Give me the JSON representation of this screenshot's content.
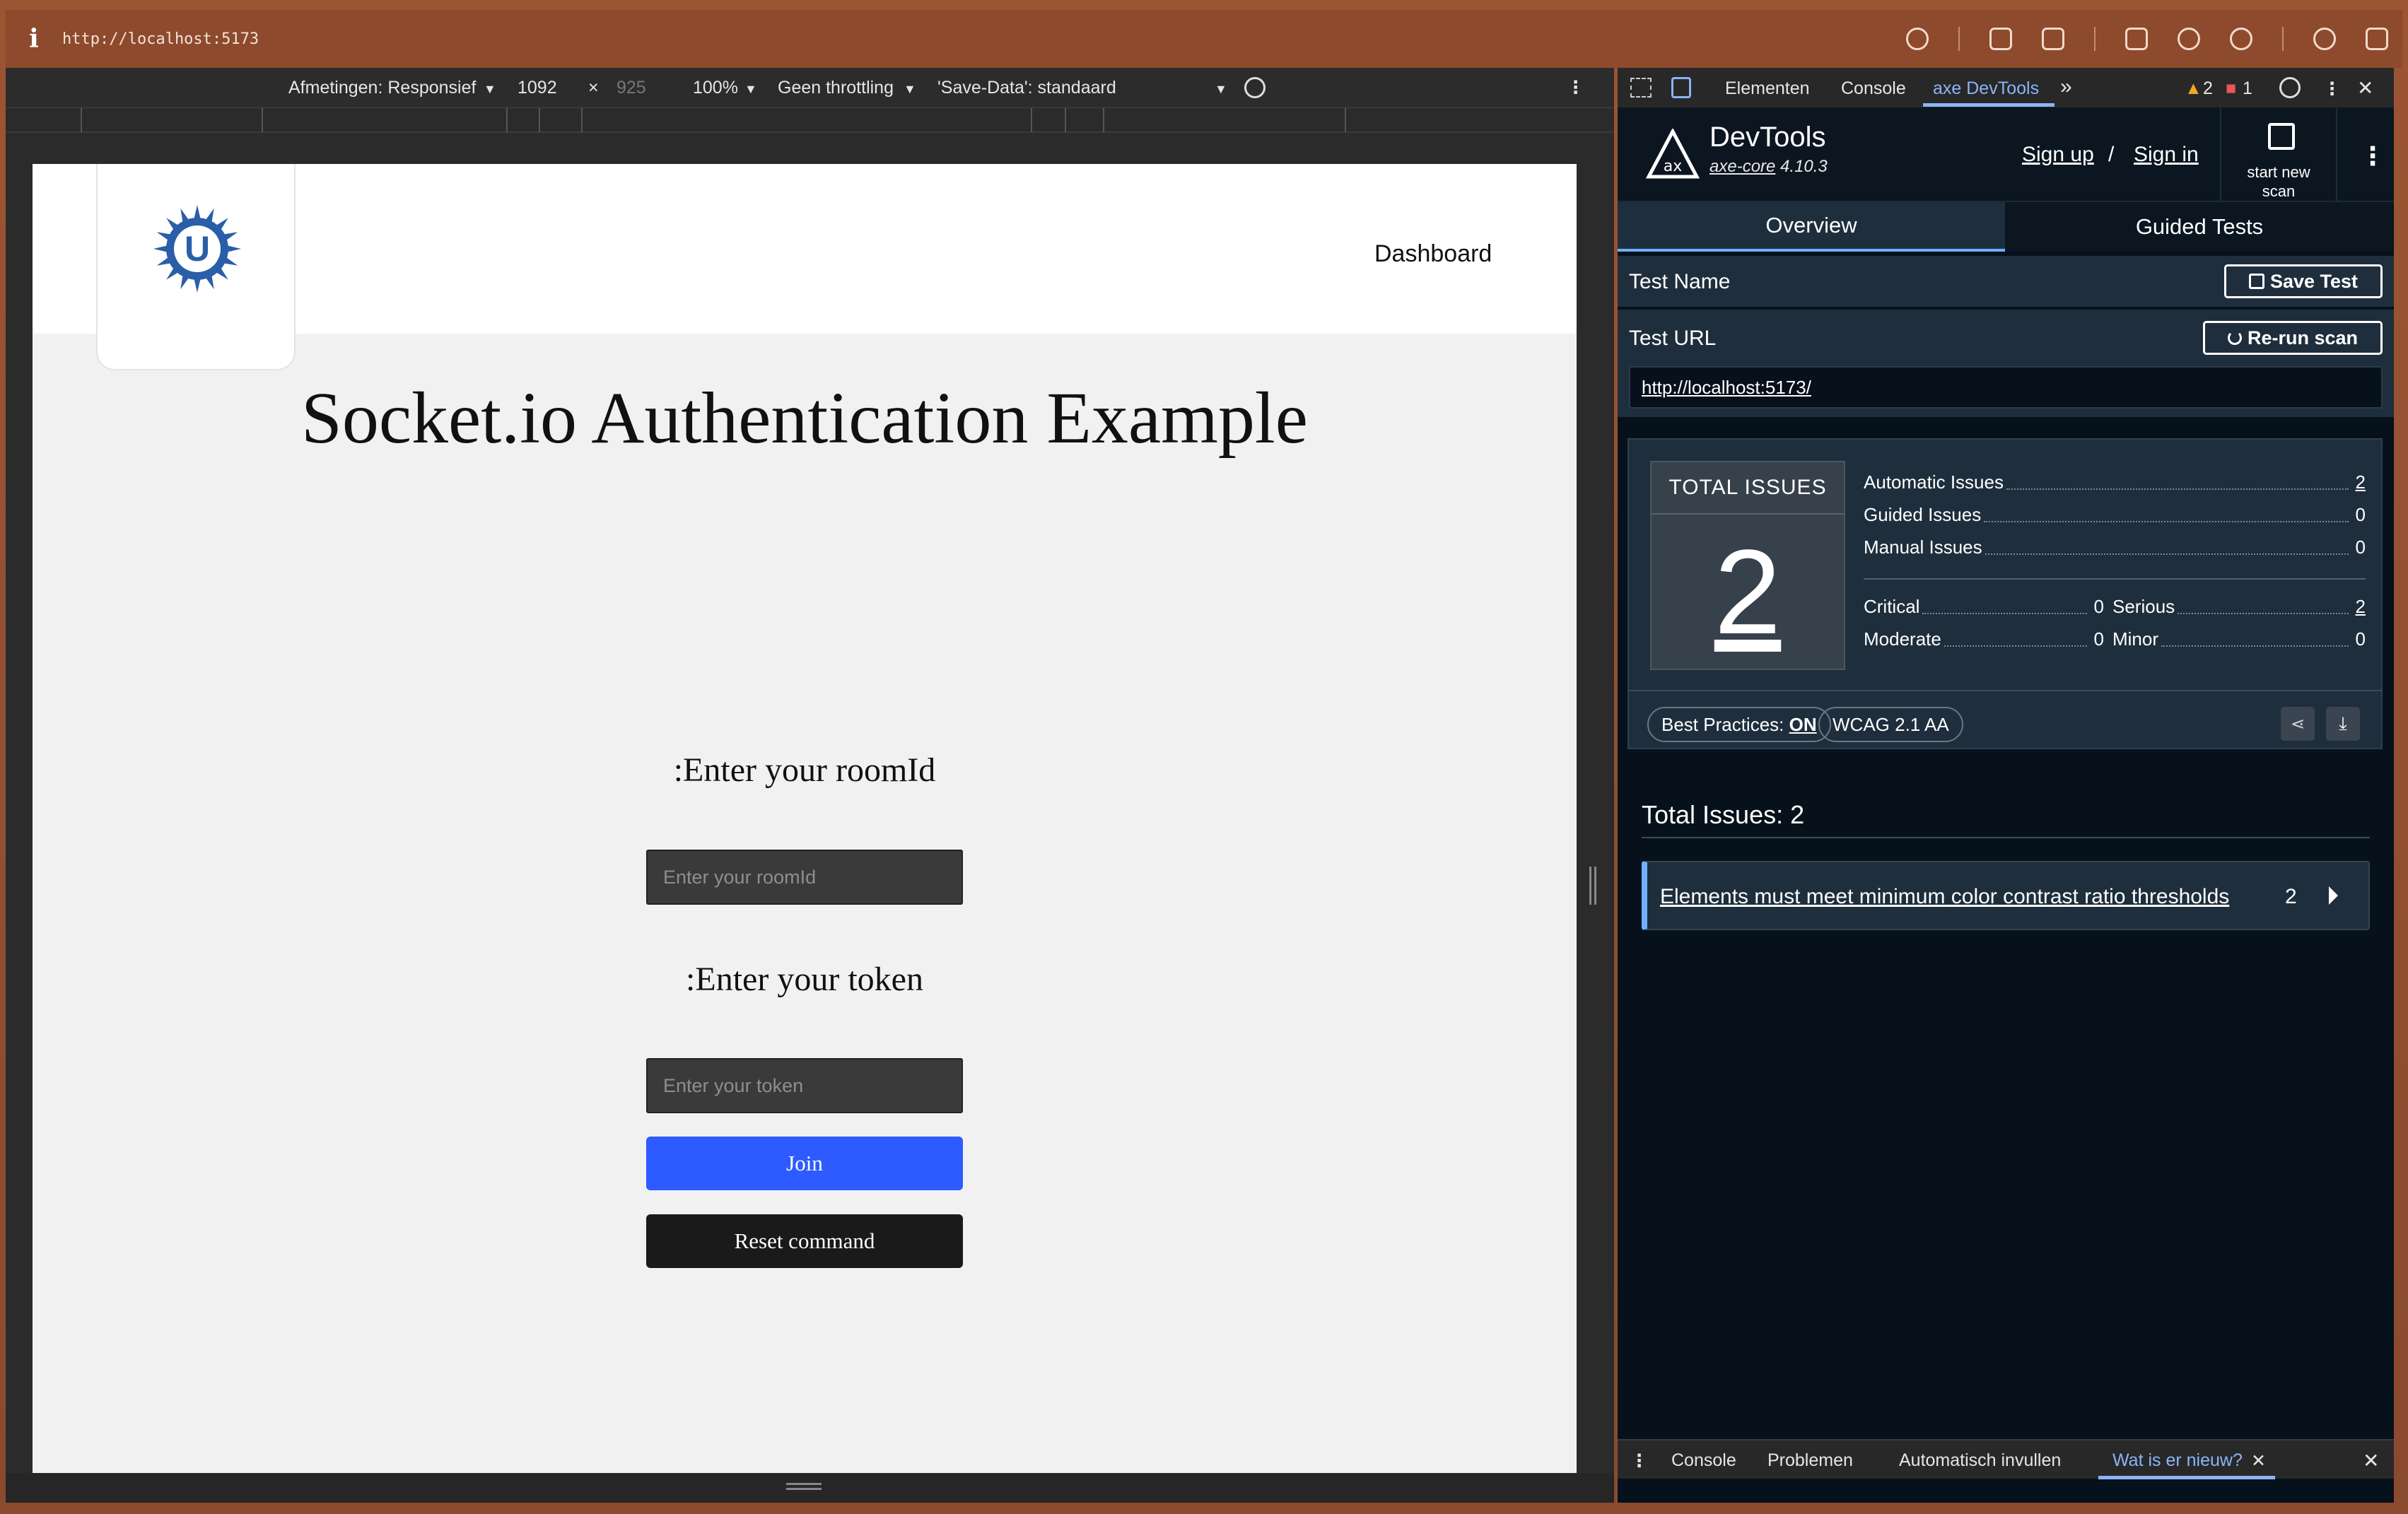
{
  "browser": {
    "info_icon": "i",
    "url": "http://localhost:5173"
  },
  "device_toolbar": {
    "dimensions_label": "Afmetingen: Responsief",
    "width": "1092",
    "times": "×",
    "height": "925",
    "zoom": "100%",
    "throttling": "Geen throttling",
    "save_data": "'Save-Data': standaard"
  },
  "page": {
    "nav_link": "Dashboard",
    "title": "Socket.io Authentication Example",
    "room_label": ":Enter your roomId",
    "room_placeholder": "Enter your roomId",
    "token_label": ":Enter your token",
    "token_placeholder": "Enter your token",
    "join_label": "Join",
    "reset_label": "Reset command",
    "logo_letter": "U",
    "logo_color": "#2a5ea8",
    "join_color": "#2d5bff"
  },
  "devtools_tabs": {
    "elements": "Elementen",
    "console": "Console",
    "axe": "axe DevTools",
    "more": "»",
    "warnings": "2",
    "errors": "1"
  },
  "axe": {
    "brand": "DevTools",
    "core_name": "axe-core",
    "core_version": "4.10.3",
    "sign_up": "Sign up",
    "slash": "/",
    "sign_in": "Sign in",
    "new_scan_line1": "start new",
    "new_scan_line2": "scan",
    "tab_overview": "Overview",
    "tab_guided": "Guided Tests",
    "test_name_label": "Test Name",
    "save_test": "Save Test",
    "test_url_label": "Test URL",
    "rerun": "Re-run scan",
    "test_url": "http://localhost:5173/",
    "total_issues_header": "TOTAL ISSUES",
    "total_issues": "2",
    "stats": {
      "automatic_label": "Automatic Issues",
      "automatic": "2",
      "guided_label": "Guided Issues",
      "guided": "0",
      "manual_label": "Manual Issues",
      "manual": "0",
      "critical_label": "Critical",
      "critical": "0",
      "serious_label": "Serious",
      "serious": "2",
      "moderate_label": "Moderate",
      "moderate": "0",
      "minor_label": "Minor",
      "minor": "0"
    },
    "best_practices_label": "Best Practices:",
    "best_practices_value": "ON",
    "wcag": "WCAG 2.1 AA",
    "total_heading": "Total Issues: 2",
    "issue_title": "Elements must meet minimum color contrast ratio thresholds",
    "issue_count": "2"
  },
  "drawer": {
    "console": "Console",
    "problems": "Problemen",
    "autofill": "Automatisch invullen",
    "whats_new": "Wat is er nieuw?"
  }
}
